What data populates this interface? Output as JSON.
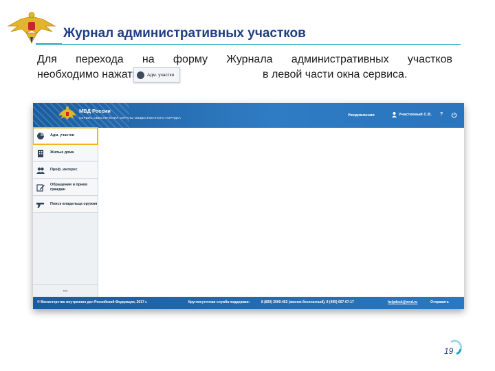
{
  "slide": {
    "title": "Журнал административных участков",
    "instruction_line1": [
      "Для",
      "перехода",
      "на",
      "форму",
      "Журнала",
      "административных",
      "участков"
    ],
    "instruction_line2_part1": "необходимо нажать кнопку",
    "instruction_line2_part2": "в левой части окна сервиса.",
    "inline_button_label": "Адм. участки",
    "page_number": "19"
  },
  "app": {
    "header": {
      "title": "МВД России",
      "subtitle": "СЕРВИС ОБЕСПЕЧЕНИЯ ОХРАНЫ ОБЩЕСТВЕННОГО ПОРЯДКА",
      "notifications": "Уведомления",
      "user": "Участковый С.В.",
      "help": "?"
    },
    "sidebar": {
      "items": [
        {
          "label": "Адм. участки",
          "icon": "pie-chart-icon",
          "active": true
        },
        {
          "label": "Жилые дома",
          "icon": "building-icon",
          "active": false
        },
        {
          "label": "Проф. интерес",
          "icon": "people-icon",
          "active": false
        },
        {
          "label": "Обращения и прием граждан",
          "icon": "edit-icon",
          "active": false
        },
        {
          "label": "Поиск владельца оружия",
          "icon": "gun-icon",
          "active": false
        }
      ],
      "collapse": "««"
    },
    "footer": {
      "copyright": "© Министерство внутренних дел Российской Федерации, 2017 г.",
      "support_label": "Круглосуточная служба поддержки:",
      "phones": "8 (800) 2000-462 (звонок бесплатный), 8 (495) 667-67-17",
      "email": "helpdesk@mvd.ru",
      "send": "Отправить"
    }
  },
  "colors": {
    "title": "#1f3e86",
    "accent_rule": "#1aa6b7",
    "header_blue": "#2f7cc4",
    "active_outline": "#f3b41b"
  }
}
